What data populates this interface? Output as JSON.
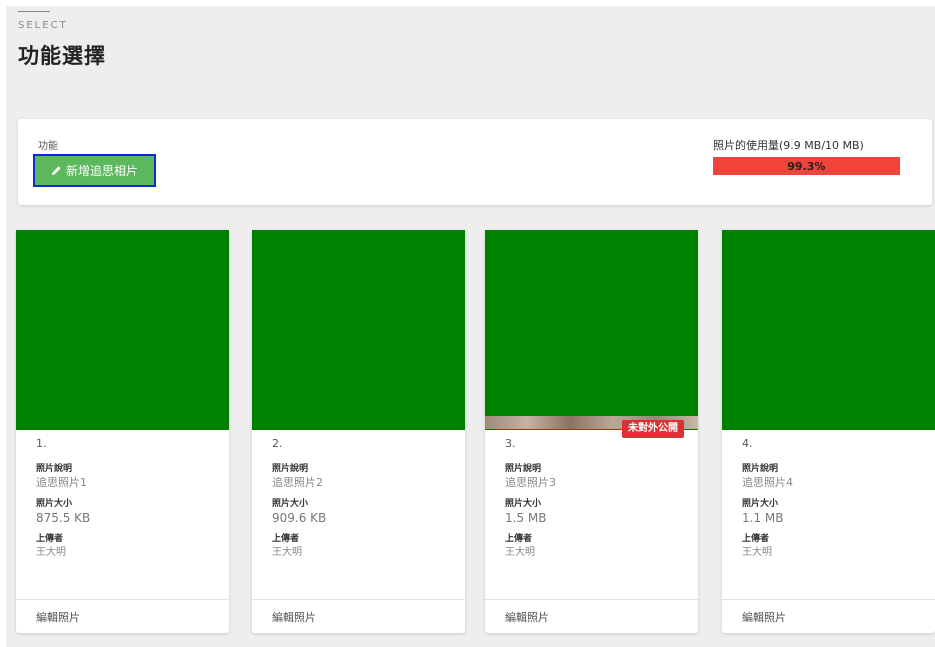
{
  "header": {
    "eyebrow": "SELECT",
    "title": "功能選擇"
  },
  "panel": {
    "label": "功能",
    "add_button_label": "新增追思相片",
    "usage_label": "照片的使用量(9.9 MB/10 MB)",
    "usage_percent_text": "99.3%",
    "usage_fraction": 0.993
  },
  "colors": {
    "accent_green": "#5cb85c",
    "focus_outline": "#0a2bd6",
    "usage_bar": "#f0443a",
    "image_placeholder": "#008000",
    "badge_red": "#dc3034"
  },
  "labels": {
    "description": "照片說明",
    "size": "照片大小",
    "uploader": "上傳者",
    "edit": "編輯照片"
  },
  "cards": [
    {
      "index": "1.",
      "description": "追思照片1",
      "size": "875.5 KB",
      "uploader": "王大明"
    },
    {
      "index": "2.",
      "description": "追思照片2",
      "size": "909.6 KB",
      "uploader": "王大明"
    },
    {
      "index": "3.",
      "description": "追思照片3",
      "size": "1.5 MB",
      "uploader": "王大明",
      "badge": "未對外公開"
    },
    {
      "index": "4.",
      "description": "追思照片4",
      "size": "1.1 MB",
      "uploader": "王大明"
    }
  ]
}
